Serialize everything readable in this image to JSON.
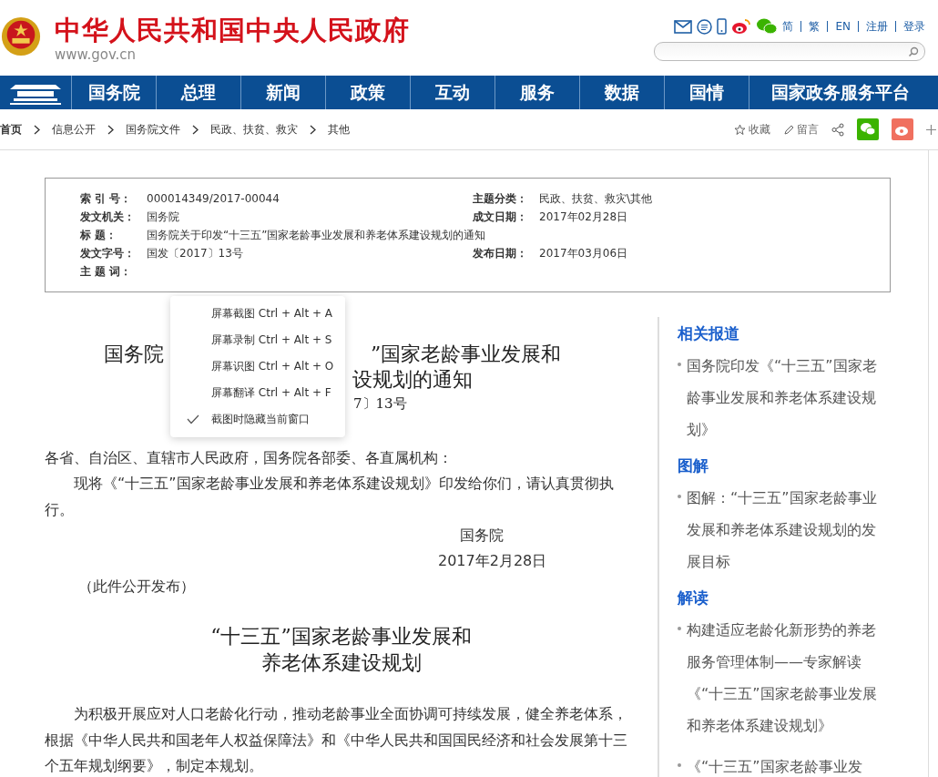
{
  "header": {
    "title": "中华人民共和国中央人民政府",
    "site_url": "www.gov.cn",
    "top_links": [
      "简",
      "繁",
      "EN",
      "注册",
      "登录"
    ]
  },
  "nav": {
    "items": [
      "国务院",
      "总理",
      "新闻",
      "政策",
      "互动",
      "服务",
      "数据",
      "国情",
      "国家政务服务平台"
    ]
  },
  "breadcrumb": {
    "items": [
      "首页",
      "信息公开",
      "国务院文件",
      "民政、扶贫、救灾",
      "其他"
    ],
    "actions": [
      "收藏",
      "留言"
    ]
  },
  "info": {
    "rows": [
      {
        "cells": [
          {
            "label": "索 引 号：",
            "value": "000014349/2017-00044"
          },
          {
            "label": "主题分类：",
            "value": "民政、扶贫、救灾\\其他"
          }
        ]
      },
      {
        "cells": [
          {
            "label": "发文机关：",
            "value": "国务院"
          },
          {
            "label": "成文日期：",
            "value": "2017年02月28日"
          }
        ]
      },
      {
        "cells": [
          {
            "label": "标 题：",
            "value": "国务院关于印发“十三五”国家老龄事业发展和养老体系建设规划的通知"
          }
        ]
      },
      {
        "cells": [
          {
            "label": "发文字号：",
            "value": "国发〔2017〕13号"
          },
          {
            "label": "发布日期：",
            "value": "2017年03月06日"
          }
        ]
      },
      {
        "cells": [
          {
            "label": "主 题 词："
          }
        ]
      }
    ]
  },
  "context_menu": {
    "items": [
      {
        "label": "屏幕截图 Ctrl + Alt + A",
        "checked": false
      },
      {
        "label": "屏幕录制 Ctrl + Alt + S",
        "checked": false
      },
      {
        "label": "屏幕识图 Ctrl + Alt + O",
        "checked": false
      },
      {
        "label": "屏幕翻译 Ctrl + Alt + F",
        "checked": false
      },
      {
        "label": "截图时隐藏当前窗口",
        "checked": true
      }
    ]
  },
  "document": {
    "title_visible": [
      "国务院",
      "”国家老龄事业发展和",
      "设规划的通知"
    ],
    "number_visible": "7〕13号",
    "salutation": "各省、自治区、直辖市人民政府，国务院各部委、各直属机构：",
    "notice": "现将《“十三五”国家老龄事业发展和养老体系建设规划》印发给你们，请认真贯彻执行。",
    "signer": "国务院",
    "date": "2017年2月28日",
    "note": "（此件公开发布）",
    "plan_title": [
      "“十三五”国家老龄事业发展和",
      "养老体系建设规划"
    ],
    "plan_intro": "为积极开展应对人口老龄化行动，推动老龄事业全面协调可持续发展，健全养老体系，根据《中华人民共和国老年人权益保障法》和《中华人民共和国国民经济和社会发展第十三个五年规划纲要》，制定本规划。"
  },
  "sidebar": {
    "sections": [
      {
        "heading": "相关报道",
        "items": [
          "国务院印发《“十三五”国家老龄事业发展和养老体系建设规划》"
        ]
      },
      {
        "heading": "图解",
        "items": [
          "图解：“十三五”国家老龄事业发展和养老体系建设规划的发展目标"
        ]
      },
      {
        "heading": "解读",
        "items": [
          "构建适应老龄化新形势的养老服务管理体制——专家解读《“十三五”国家老龄事业发展和养老体系建设规划》",
          "《“十三五”国家老龄事业发"
        ]
      }
    ]
  }
}
